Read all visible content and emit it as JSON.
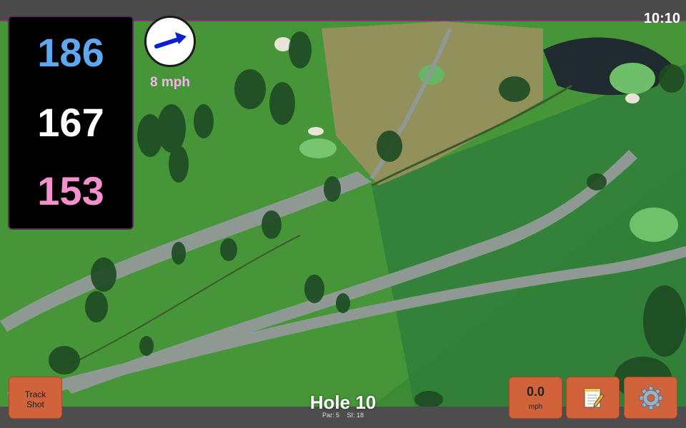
{
  "status_bar": {
    "time": "10:10"
  },
  "yardages": {
    "back": "186",
    "center": "167",
    "front": "153"
  },
  "wind": {
    "speed": "8 mph",
    "direction_icon": "arrow-up-right-icon",
    "arrow_color": "#0a1fd6"
  },
  "buttons": {
    "track_shot": {
      "line1": "Track",
      "line2": "Shot"
    },
    "speed": {
      "value": "0.0",
      "unit": "mph"
    },
    "notes_icon": "notepad-icon",
    "settings_icon": "gear-icon"
  },
  "hole": {
    "title": "Hole 10",
    "par": "Par: 5",
    "si": "SI: 18"
  },
  "colors": {
    "accent": "#d1633a",
    "back_yardage": "#5fa8f0",
    "front_yardage": "#f58fcd",
    "wind_text": "#f3b5e8"
  }
}
